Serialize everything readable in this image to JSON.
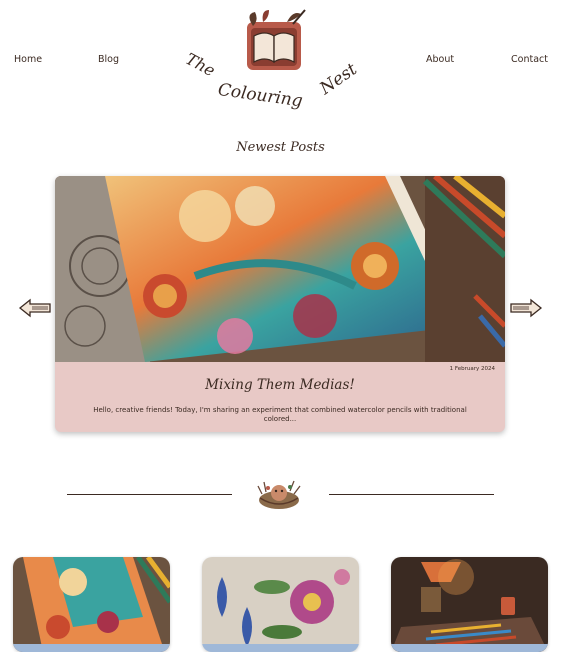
{
  "nav": {
    "links": [
      "Home",
      "Blog",
      "About",
      "Contact"
    ]
  },
  "brand": {
    "logo_text": "The Colouring Nest"
  },
  "section": {
    "title": "Newest Posts"
  },
  "featured_post": {
    "date": "1 February 2024",
    "title": "Mixing Them Medias!",
    "excerpt": "Hello, creative friends! Today, I'm sharing an experiment that combined watercolor pencils with traditional colored..."
  },
  "colors": {
    "text": "#3b2a22",
    "card_bg": "#e8c9c6",
    "card_strip": "#9fb8d8"
  },
  "icons": [
    "book-logo-icon",
    "arrow-left-icon",
    "arrow-right-icon",
    "nest-emblem-icon"
  ]
}
